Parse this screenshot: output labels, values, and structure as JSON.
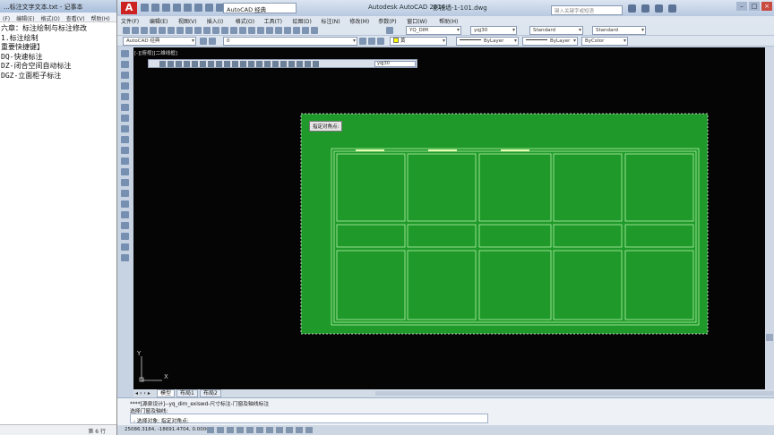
{
  "notepad": {
    "title": "...标注文字文本.txt - 记事本",
    "menu": [
      "(F)",
      "编辑(E)",
      "格式(O)",
      "查看(V)",
      "帮助(H)"
    ],
    "lines": [
      "六章：标注绘制与标注修改",
      "1.标注绘制",
      "重要快捷键】",
      "DQ-快速标注",
      "DZ-闭合空间自动标注",
      "DGZ-立面柜子标注"
    ],
    "status": "第 6 行"
  },
  "acad": {
    "logo": "A",
    "workspace": "AutoCAD 经典",
    "app_name": "Autodesk AutoCAD 2014",
    "doc_name": "影视墙-1-101.dwg",
    "search_placeholder": "键入关键字或短语",
    "menu": [
      "文件(F)",
      "编辑(E)",
      "视图(V)",
      "插入(I)",
      "格式(O)",
      "工具(T)",
      "绘图(D)",
      "标注(N)",
      "修改(M)",
      "参数(P)",
      "窗口(W)",
      "帮助(H)"
    ],
    "row1": {
      "dimstyle": "YQ_DIM",
      "textstyle": "yqj30",
      "tablestyle": "Standard",
      "mleaderstyle": "Standard"
    },
    "row2": {
      "workspace": "AutoCAD 经典",
      "layer": "0",
      "color": "黄",
      "linetype": "ByLayer",
      "lineweight": "ByLayer",
      "plotstyle": "ByColor"
    },
    "viewport_label": "[-][俯视][二维线框]",
    "float_combo": "yqj30",
    "prompt": "指定对角点:",
    "ucs_y": "Y",
    "ucs_x": "X",
    "tabs": [
      "模型",
      "布局1",
      "布局2"
    ],
    "cmd_lines": [
      "****[源泉设计]--yq_dim_exlswd-尺寸标注-门窗及轴线标注",
      "选择门窗及轴线:"
    ],
    "cmd_input": "- 选择对象: 指定对角点:",
    "coords": "25086.3184, -18691.4704, 0.0000",
    "colors": {
      "selection_fill": "#1f9a2a",
      "drawing_line": "#b6f0a8",
      "background": "#050505"
    }
  }
}
